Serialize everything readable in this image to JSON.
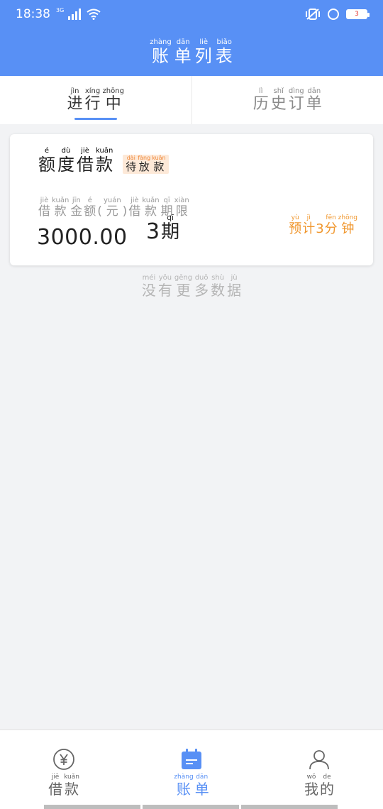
{
  "status_bar": {
    "time": "18:38",
    "network_tag": "3G",
    "battery_level": "3",
    "icons": [
      "signal-icon",
      "wifi-icon",
      "vibrate-icon",
      "lock-rotation-icon",
      "battery-icon"
    ]
  },
  "header": {
    "title": [
      {
        "p": "zhàng",
        "c": "账"
      },
      {
        "p": "dān",
        "c": "单"
      },
      {
        "p": "liè",
        "c": "列"
      },
      {
        "p": "biǎo",
        "c": "表"
      }
    ]
  },
  "tabs": [
    {
      "chars": [
        {
          "p": "jìn",
          "c": "进"
        },
        {
          "p": "xíng",
          "c": "行"
        },
        {
          "p": "zhōng",
          "c": "中"
        }
      ],
      "active": true
    },
    {
      "chars": [
        {
          "p": "lì",
          "c": "历"
        },
        {
          "p": "shǐ",
          "c": "史"
        },
        {
          "p": "dìng",
          "c": "订"
        },
        {
          "p": "dān",
          "c": "单"
        }
      ],
      "active": false
    }
  ],
  "card": {
    "title": [
      {
        "p": "é",
        "c": "额"
      },
      {
        "p": "dù",
        "c": "度"
      },
      {
        "p": "jiè",
        "c": "借"
      },
      {
        "p": "kuǎn",
        "c": "款"
      }
    ],
    "badge": [
      {
        "p": "dài",
        "c": "待"
      },
      {
        "p": "fàng",
        "c": "放"
      },
      {
        "p": "kuǎn",
        "c": "款"
      }
    ],
    "label_amount": [
      {
        "p": "jiè",
        "c": "借"
      },
      {
        "p": "kuǎn",
        "c": "款"
      },
      {
        "p": "jīn",
        "c": "金"
      },
      {
        "p": "é",
        "c": "额"
      }
    ],
    "label_amount_unit_open": "(",
    "label_amount_unit": [
      {
        "p": "yuán",
        "c": "元"
      }
    ],
    "label_amount_unit_close": ")",
    "label_term": [
      {
        "p": "jiè",
        "c": "借"
      },
      {
        "p": "kuǎn",
        "c": "款"
      },
      {
        "p": "qī",
        "c": "期"
      },
      {
        "p": "xiàn",
        "c": "限"
      }
    ],
    "amount_value": "3000.00",
    "term_value": "3",
    "term_unit": {
      "p": "qī",
      "c": "期"
    },
    "eta_prefix": [
      {
        "p": "yù",
        "c": "预"
      },
      {
        "p": "jì",
        "c": "计"
      }
    ],
    "eta_value": "3",
    "eta_suffix": [
      {
        "p": "fēn",
        "c": "分"
      },
      {
        "p": "zhōng",
        "c": "钟"
      }
    ]
  },
  "no_more": [
    {
      "p": "méi",
      "c": "没"
    },
    {
      "p": "yǒu",
      "c": "有"
    },
    {
      "p": "gēng",
      "c": "更"
    },
    {
      "p": "duō",
      "c": "多"
    },
    {
      "p": "shù",
      "c": "数"
    },
    {
      "p": "jù",
      "c": "据"
    }
  ],
  "bottom_nav": [
    {
      "icon": "yuan-icon",
      "chars": [
        {
          "p": "jiē",
          "c": "借"
        },
        {
          "p": "kuǎn",
          "c": "款"
        }
      ],
      "active": false
    },
    {
      "icon": "bill-icon",
      "chars": [
        {
          "p": "zhàng",
          "c": "账"
        },
        {
          "p": "dān",
          "c": "单"
        }
      ],
      "active": true
    },
    {
      "icon": "user-icon",
      "chars": [
        {
          "p": "wǒ",
          "c": "我"
        },
        {
          "p": "de",
          "c": "的"
        }
      ],
      "active": false
    }
  ],
  "colors": {
    "brand_blue": "#5890f5",
    "orange": "#f0962c",
    "badge_bg": "#fde9d8"
  }
}
